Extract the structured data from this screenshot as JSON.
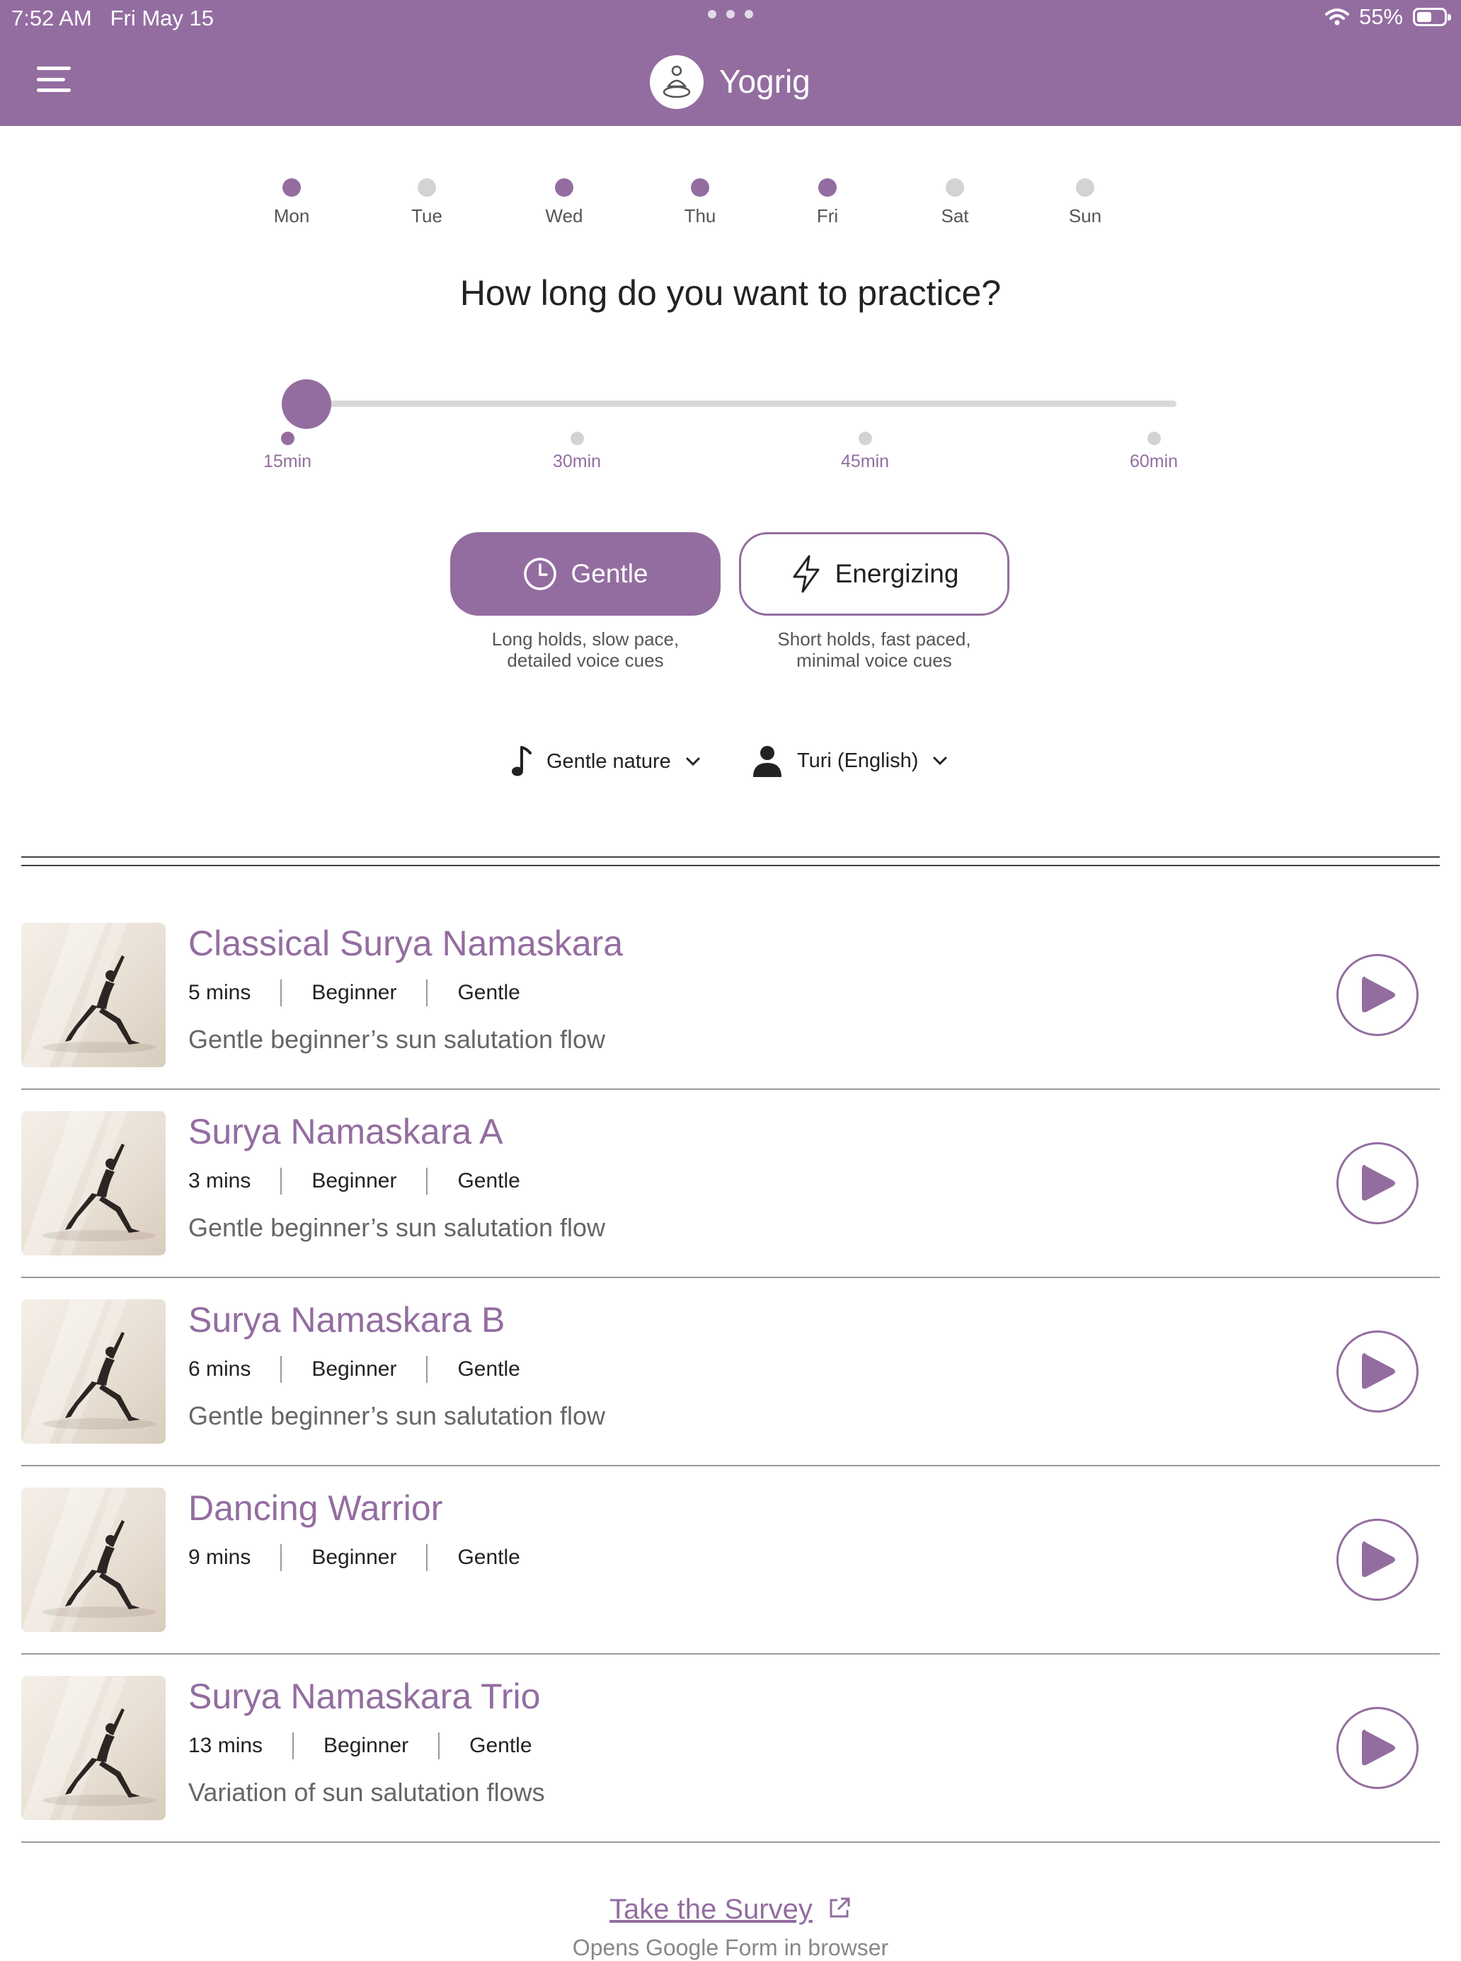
{
  "status_bar": {
    "time": "7:52 AM",
    "date": "Fri May 15",
    "battery": "55%",
    "battery_level": 0.55
  },
  "app": {
    "title": "Yogrig",
    "accent_color": "#936da0"
  },
  "days": [
    {
      "label": "Mon",
      "active": true
    },
    {
      "label": "Tue",
      "active": false
    },
    {
      "label": "Wed",
      "active": true
    },
    {
      "label": "Thu",
      "active": true
    },
    {
      "label": "Fri",
      "active": true
    },
    {
      "label": "Sat",
      "active": false
    },
    {
      "label": "Sun",
      "active": false
    }
  ],
  "question": "How long do you want to practice?",
  "duration": {
    "options": [
      "15min",
      "30min",
      "45min",
      "60min"
    ],
    "selected": "15min"
  },
  "pace": {
    "gentle": {
      "label": "Gentle",
      "description": "Long holds, slow pace, detailed voice cues",
      "icon": "clock-icon",
      "selected": true
    },
    "energizing": {
      "label": "Energizing",
      "description": "Short holds, fast paced, minimal voice cues",
      "icon": "lightning-icon",
      "selected": false
    }
  },
  "music": {
    "icon": "music-note-icon",
    "value": "Gentle nature"
  },
  "voice": {
    "icon": "person-icon",
    "value": "Turi (English)"
  },
  "routines": [
    {
      "title": "Classical Surya Namaskara",
      "duration": "5 mins",
      "level": "Beginner",
      "style": "Gentle",
      "description": "Gentle beginner’s sun salutation flow"
    },
    {
      "title": "Surya Namaskara A",
      "duration": "3 mins",
      "level": "Beginner",
      "style": "Gentle",
      "description": "Gentle beginner’s sun salutation flow"
    },
    {
      "title": "Surya Namaskara B",
      "duration": "6 mins",
      "level": "Beginner",
      "style": "Gentle",
      "description": "Gentle beginner’s sun salutation flow"
    },
    {
      "title": "Dancing Warrior",
      "duration": "9 mins",
      "level": "Beginner",
      "style": "Gentle",
      "description": ""
    },
    {
      "title": "Surya Namaskara Trio",
      "duration": "13 mins",
      "level": "Beginner",
      "style": "Gentle",
      "description": "Variation of sun salutation flows"
    }
  ],
  "survey": {
    "label": "Take the Survey",
    "subtitle": "Opens Google Form in browser"
  }
}
